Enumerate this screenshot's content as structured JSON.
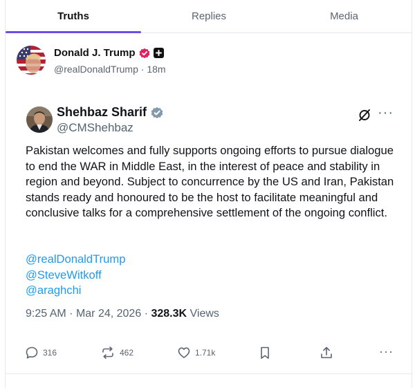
{
  "tabs": [
    {
      "label": "Truths",
      "active": true
    },
    {
      "label": "Replies",
      "active": false
    },
    {
      "label": "Media",
      "active": false
    }
  ],
  "post": {
    "author_name": "Donald J. Trump",
    "handle": "@realDonaldTrump",
    "separator": "·",
    "time_ago": "18m",
    "accent_color": "#6b4ce6",
    "verified_color": "#e0245e"
  },
  "embed": {
    "author_name": "Shehbaz Sharif",
    "handle": "@CMShehbaz",
    "body": "Pakistan welcomes and fully supports ongoing efforts to pursue dialogue to end the WAR in Middle East, in the interest of peace and stability in region and beyond. Subject to concurrence by the US and Iran, Pakistan stands ready and honoured to be the host to facilitate meaningful and conclusive talks for a comprehensive settlement of the ongoing conflict.",
    "mentions": [
      "@realDonaldTrump",
      "@SteveWitkoff",
      "@araghchi"
    ],
    "time": "9:25 AM",
    "date": "Mar 24, 2026",
    "views_count": "328.3K",
    "views_label": "Views",
    "more_label": "···",
    "link_color": "#1d9bf0"
  },
  "actions": {
    "replies": "316",
    "reposts": "462",
    "likes": "1.71k",
    "more_label": "···"
  },
  "icons": [
    "reply-icon",
    "repost-icon",
    "like-icon",
    "bookmark-icon",
    "share-icon",
    "more-icon",
    "x-logo-icon",
    "verified-badge-icon",
    "plus-badge-icon"
  ]
}
